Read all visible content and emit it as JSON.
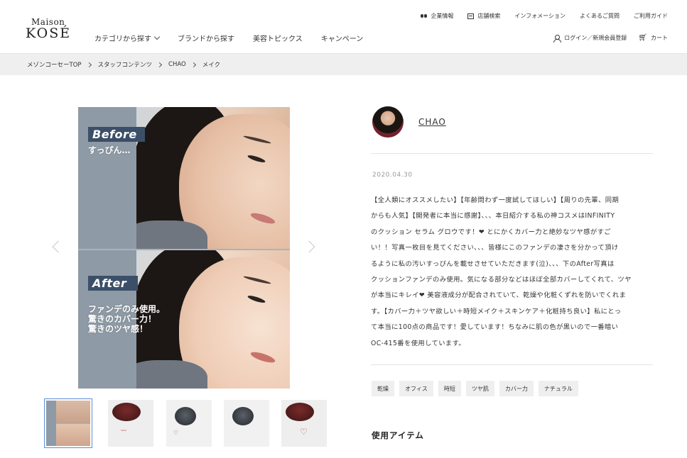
{
  "header": {
    "logo_top": "Maison",
    "logo_main": "KOSÉ",
    "main_nav": [
      {
        "label": "カテゴリから探す",
        "has_dropdown": true
      },
      {
        "label": "ブランドから探す"
      },
      {
        "label": "美容トピックス"
      },
      {
        "label": "キャンペーン"
      }
    ],
    "util_nav": [
      {
        "label": "企業情報",
        "icon": "binoculars-icon"
      },
      {
        "label": "店舗検索",
        "icon": "store-icon"
      },
      {
        "label": "インフォメーション"
      },
      {
        "label": "よくあるご質問"
      },
      {
        "label": "ご利用ガイド"
      }
    ],
    "account": {
      "login_label": "ログイン／新規会員登録",
      "cart_label": "カート"
    }
  },
  "breadcrumb": [
    "メゾンコーセーTOP",
    "スタッフコンテンツ",
    "CHAO",
    "メイク"
  ],
  "main_image": {
    "before_label": "Before",
    "before_text": "すっぴん…",
    "after_label": "After",
    "after_text_lines": [
      "ファンデのみ使用。",
      "驚きのカバー力！",
      "驚きのツヤ感！"
    ]
  },
  "thumbnails_count": 5,
  "author": {
    "name": "CHAO"
  },
  "post": {
    "date": "2020.04.30",
    "body_lines": [
      "【全人類にオススメしたい】【年齢問わず一度試してほしい】【周りの先輩、同期",
      "からも人気】【開発者に本当に感謝】、、、本日紹介する私の神コスメはINFINITY",
      "のクッション セラム グロウです！❤ とにかくカバー力と絶妙なツヤ感がすご",
      "い！！写真一枚目を見てください、、、皆様にこのファンデの凄さを分かって頂け",
      "るように私の汚いすっぴんを載せさせていただきます(泣)、、、下のAfter写真は",
      "クッションファンデのみ使用。気になる部分などはほぼ全部カバーしてくれて、ツヤ",
      "が本当にキレイ❤ 美容液成分が配合されていて、乾燥や化粧くずれを防いでくれま",
      "す。【カバー力＋ツヤ欲しい＋時短メイク＋スキンケア＋化粧持ち良い】私にとっ",
      "て本当に100点の商品です！愛しています！ちなみに肌の色が黒いので一番暗い",
      "OC-415番を使用しています。"
    ]
  },
  "tags": [
    "乾燥",
    "オフィス",
    "時短",
    "ツヤ肌",
    "カバー力",
    "ナチュラル"
  ],
  "items_heading": "使用アイテム"
}
